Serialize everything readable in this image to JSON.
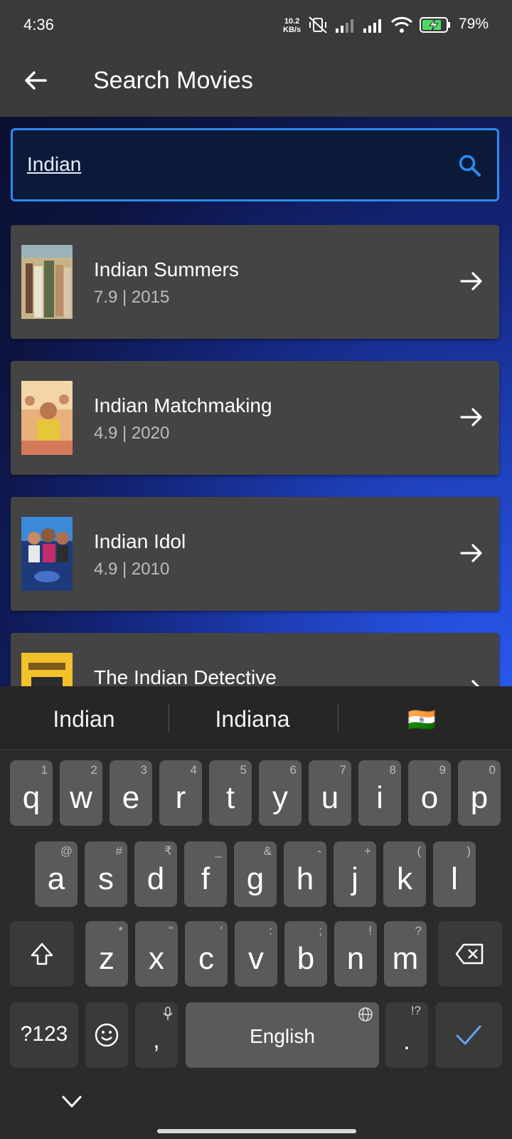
{
  "status_bar": {
    "time": "4:36",
    "speed_value": "10.2",
    "speed_unit": "KB/s",
    "battery": "79%"
  },
  "app_bar": {
    "title": "Search Movies",
    "back_icon": "arrow-left-icon"
  },
  "search": {
    "value": "Indian",
    "icon": "search-icon",
    "accent_color": "#2a8cf0"
  },
  "results": [
    {
      "title": "Indian Summers",
      "meta": "7.9 | 2015"
    },
    {
      "title": "Indian Matchmaking",
      "meta": "4.9 | 2020"
    },
    {
      "title": "Indian Idol",
      "meta": "4.9 | 2010"
    },
    {
      "title": "The Indian Detective",
      "meta": ""
    }
  ],
  "keyboard": {
    "suggestions": [
      "Indian",
      "Indiana",
      "🇮🇳"
    ],
    "row1": [
      {
        "k": "q",
        "h": "1"
      },
      {
        "k": "w",
        "h": "2"
      },
      {
        "k": "e",
        "h": "3"
      },
      {
        "k": "r",
        "h": "4"
      },
      {
        "k": "t",
        "h": "5"
      },
      {
        "k": "y",
        "h": "6"
      },
      {
        "k": "u",
        "h": "7"
      },
      {
        "k": "i",
        "h": "8"
      },
      {
        "k": "o",
        "h": "9"
      },
      {
        "k": "p",
        "h": "0"
      }
    ],
    "row2": [
      {
        "k": "a",
        "h": "@"
      },
      {
        "k": "s",
        "h": "#"
      },
      {
        "k": "d",
        "h": "₹"
      },
      {
        "k": "f",
        "h": "_"
      },
      {
        "k": "g",
        "h": "&"
      },
      {
        "k": "h",
        "h": "-"
      },
      {
        "k": "j",
        "h": "+"
      },
      {
        "k": "k",
        "h": "("
      },
      {
        "k": "l",
        "h": ")"
      }
    ],
    "row3": [
      {
        "k": "z",
        "h": "*"
      },
      {
        "k": "x",
        "h": "\""
      },
      {
        "k": "c",
        "h": "'"
      },
      {
        "k": "v",
        "h": ":"
      },
      {
        "k": "b",
        "h": ";"
      },
      {
        "k": "n",
        "h": "!"
      },
      {
        "k": "m",
        "h": "?"
      }
    ],
    "symbols_label": "?123",
    "comma": ",",
    "space_label": "English",
    "period": ".",
    "period_hint": "!?"
  }
}
